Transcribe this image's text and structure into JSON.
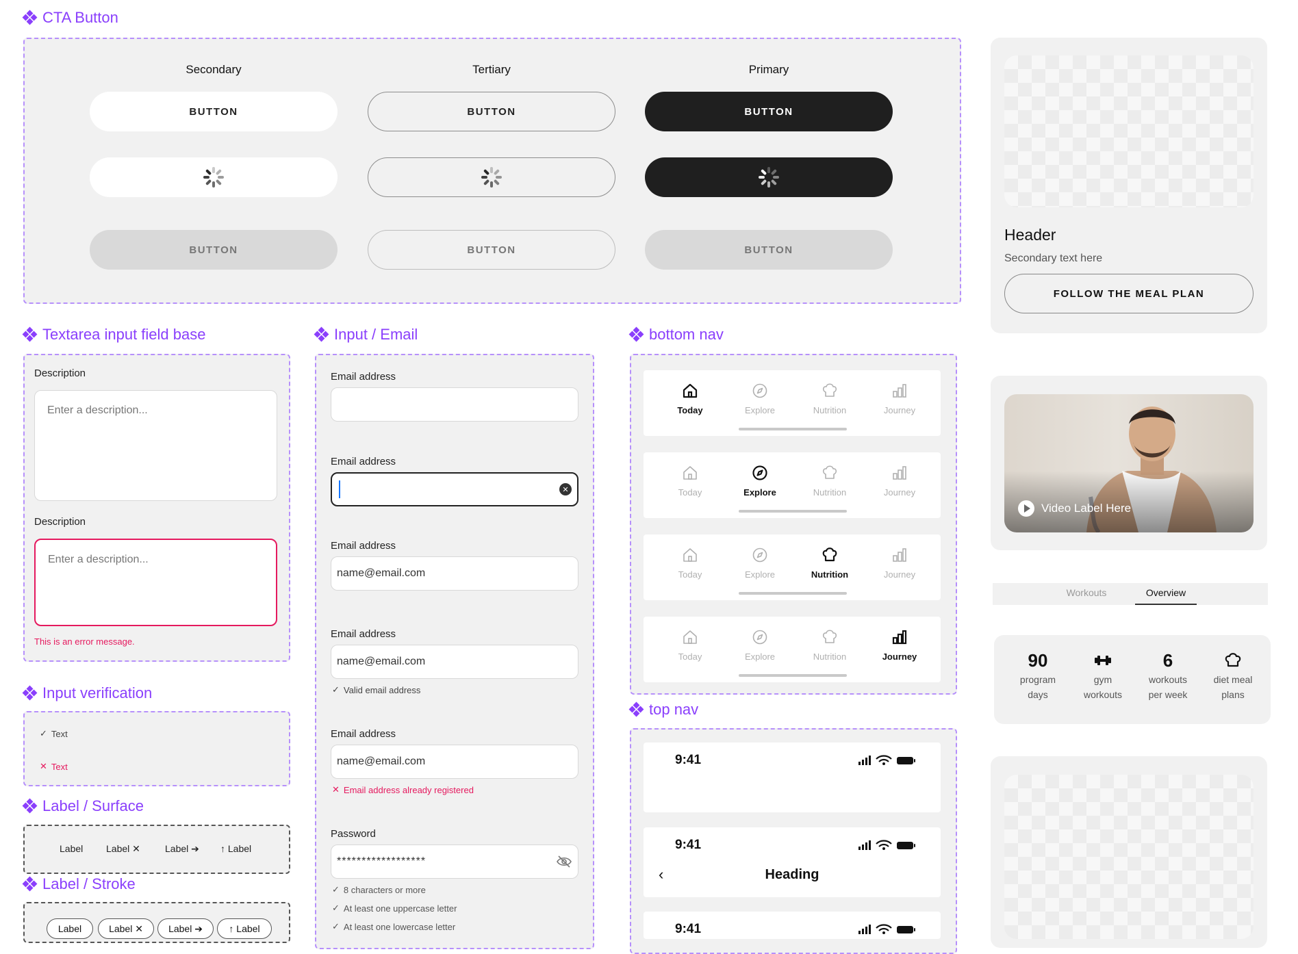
{
  "sections": {
    "cta": "CTA Button",
    "textarea": "Textarea input field base",
    "input_email": "Input / Email",
    "bottom_nav": "bottom nav",
    "input_verification": "Input verification",
    "label_surface": "Label / Surface",
    "label_stroke": "Label / Stroke",
    "top_nav": "top nav"
  },
  "cta": {
    "columns": [
      "Secondary",
      "Tertiary",
      "Primary"
    ],
    "button_label": "BUTTON"
  },
  "textarea": {
    "label": "Description",
    "placeholder": "Enter a description...",
    "error": "This is an error message."
  },
  "email": {
    "label": "Email address",
    "value": "name@email.com",
    "valid_hint": "Valid email address",
    "error_hint": "Email address already registered",
    "password_label": "Password",
    "password_value": "******************",
    "rules": [
      "8 characters or more",
      "At least one uppercase letter",
      "At least one lowercase letter"
    ]
  },
  "verification": {
    "ok": "Text",
    "error": "Text"
  },
  "labels": {
    "plain": "Label",
    "close": "Label ✕",
    "arrow": "Label ➔",
    "up": "↑ Label"
  },
  "bottom_nav": {
    "items": [
      "Today",
      "Explore",
      "Nutrition",
      "Journey"
    ],
    "icons": [
      "home-icon",
      "compass-icon",
      "chef-hat-icon",
      "chart-icon"
    ]
  },
  "top_nav": {
    "time": "9:41",
    "heading": "Heading"
  },
  "card": {
    "header": "Header",
    "secondary": "Secondary text here",
    "button": "FOLLOW THE MEAL PLAN"
  },
  "video": {
    "label": "Video Label Here"
  },
  "tabs": [
    "Workouts",
    "Overview"
  ],
  "stats": [
    {
      "big": "90",
      "line1": "program",
      "line2": "days"
    },
    {
      "big": "dumbbell-icon",
      "line1": "gym",
      "line2": "workouts"
    },
    {
      "big": "6",
      "line1": "workouts",
      "line2": "per week"
    },
    {
      "big": "chef-hat-icon",
      "line1": "diet meal",
      "line2": "plans"
    }
  ],
  "colors": {
    "accent": "#8a3ffc",
    "error": "#e5195e",
    "dark": "#1f1f1f"
  }
}
